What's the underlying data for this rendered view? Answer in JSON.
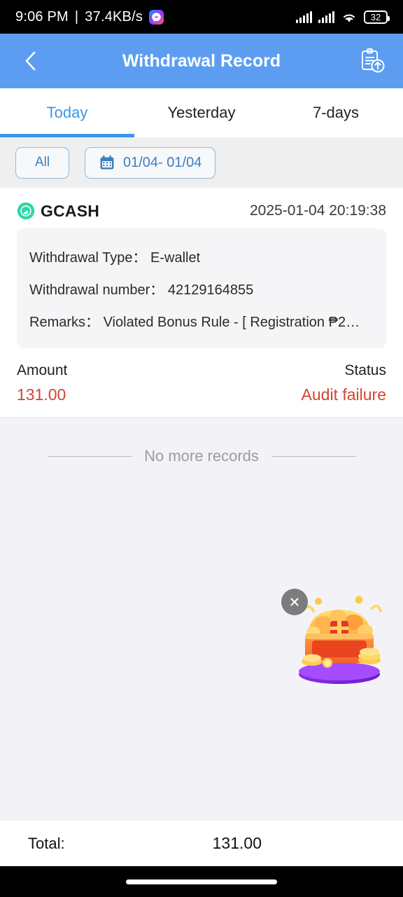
{
  "status_bar": {
    "time": "9:06 PM",
    "separator": "|",
    "network_speed": "37.4KB/s",
    "messenger_icon": "messenger-icon",
    "signal_icon": "signal-bars-icon",
    "wifi_icon": "wifi-icon",
    "battery_level": "32"
  },
  "app_bar": {
    "back_icon": "chevron-left-icon",
    "title": "Withdrawal Record",
    "export_icon": "clipboard-upload-icon",
    "background_color": "#5C9DF1"
  },
  "tabs": {
    "active_index": 0,
    "accent_color": "#3C94E8",
    "items": [
      {
        "label": "Today"
      },
      {
        "label": "Yesterday"
      },
      {
        "label": "7-days"
      }
    ]
  },
  "filter_bar": {
    "all_label": "All",
    "calendar_icon": "calendar-icon",
    "date_range": "01/04- 01/04"
  },
  "records": [
    {
      "channel_icon": "gcash-logo-icon",
      "channel": "GCASH",
      "timestamp": "2025-01-04 20:19:38",
      "details": [
        {
          "label": "Withdrawal Type：",
          "value": "E-wallet"
        },
        {
          "label": "Withdrawal number：",
          "value": "42129164855"
        },
        {
          "label": "Remarks：",
          "value": "Violated Bonus Rule - [ Registration ₱2…"
        }
      ],
      "amount_label": "Amount",
      "amount_value": "131.00",
      "status_label": "Status",
      "status_value": "Audit failure",
      "status_color": "#D4432F"
    }
  ],
  "list_footer": {
    "text": "No more records"
  },
  "promo": {
    "close_icon": "close-icon",
    "image_icon": "treasure-chest-icon"
  },
  "total_bar": {
    "label": "Total:",
    "value": "131.00"
  },
  "nav_bar": {
    "home_indicator": "home-indicator"
  }
}
